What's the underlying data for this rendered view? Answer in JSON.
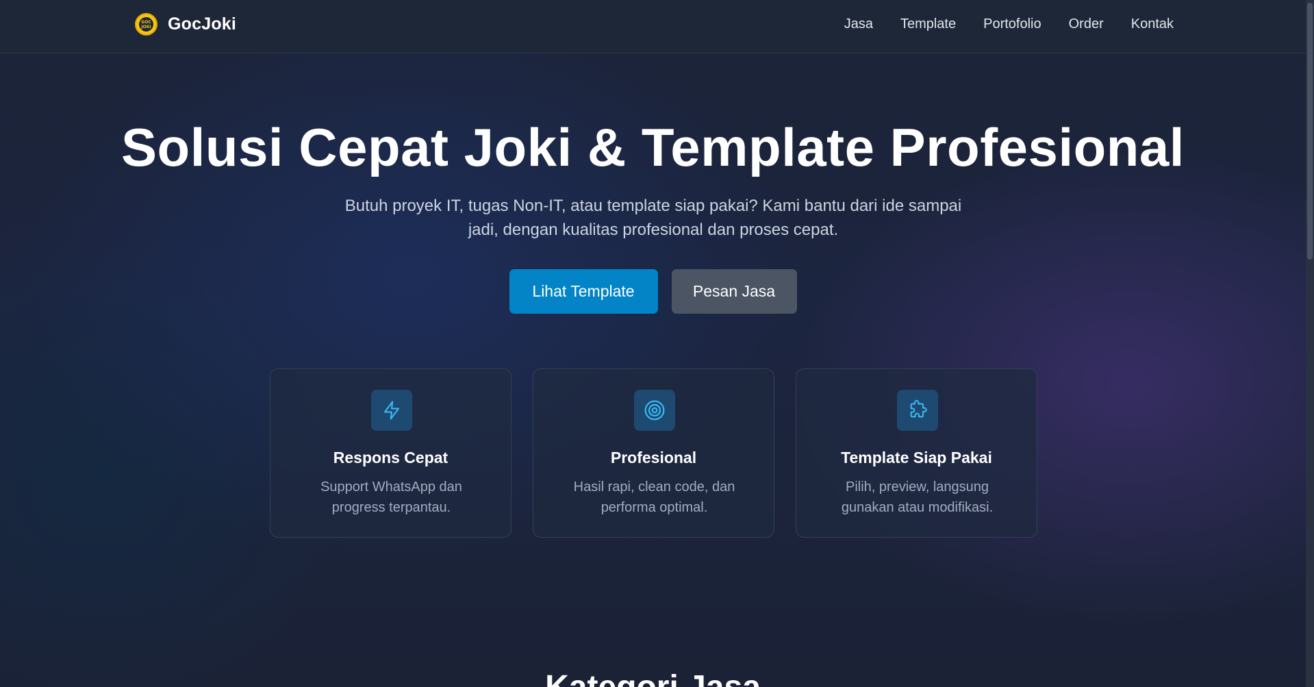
{
  "brand": {
    "name": "GocJoki",
    "logo_text": "GOC JOKI"
  },
  "nav": {
    "items": [
      "Jasa",
      "Template",
      "Portofolio",
      "Order",
      "Kontak"
    ]
  },
  "hero": {
    "title": "Solusi Cepat Joki & Template Profesional",
    "subtitle": "Butuh proyek IT, tugas Non-IT, atau template siap pakai? Kami bantu dari ide sampai jadi, dengan kualitas profesional dan proses cepat.",
    "primary_button": "Lihat Template",
    "secondary_button": "Pesan Jasa"
  },
  "features": [
    {
      "icon": "lightning-icon",
      "title": "Respons Cepat",
      "desc": "Support WhatsApp dan progress terpantau."
    },
    {
      "icon": "target-icon",
      "title": "Profesional",
      "desc": "Hasil rapi, clean code, dan performa optimal."
    },
    {
      "icon": "puzzle-icon",
      "title": "Template Siap Pakai",
      "desc": "Pilih, preview, langsung gunakan atau modifikasi."
    }
  ],
  "next_section": {
    "title": "Kategori Jasa"
  },
  "colors": {
    "accent": "#0284c7",
    "secondary_button": "#4b5563",
    "icon": "#38bdf8",
    "logo": "#f5c518"
  }
}
